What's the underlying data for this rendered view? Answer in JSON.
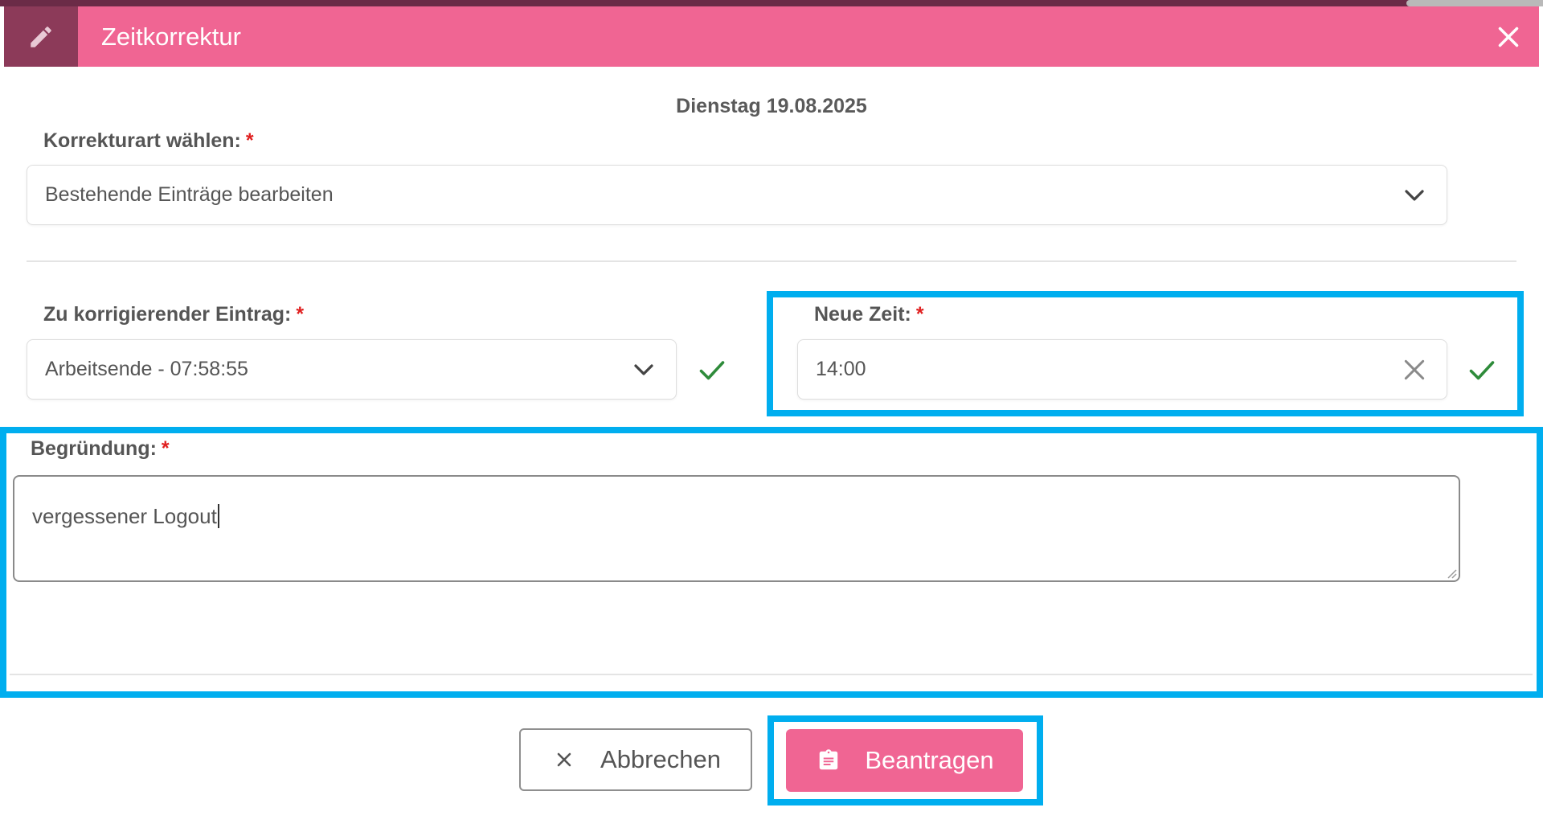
{
  "dialog": {
    "title": "Zeitkorrektur",
    "date": "Dienstag 19.08.2025"
  },
  "correction_type": {
    "label": "Korrekturart wählen:",
    "required_mark": "*",
    "value": "Bestehende Einträge bearbeiten"
  },
  "entry": {
    "label": "Zu korrigierender Eintrag:",
    "required_mark": "*",
    "value": "Arbeitsende - 07:58:55"
  },
  "new_time": {
    "label": "Neue Zeit:",
    "required_mark": "*",
    "value": "14:00"
  },
  "reason": {
    "label": "Begründung:",
    "required_mark": "*",
    "value": "vergessener Logout"
  },
  "buttons": {
    "cancel_label": "Abbrechen",
    "submit_label": "Beantragen"
  },
  "colors": {
    "header": "#f06593",
    "header_icon_bg": "#8c3a59",
    "required": "#e02020",
    "valid_check": "#2e8b3a",
    "highlight": "#00aeef"
  },
  "icons": {
    "header": "pencil-icon",
    "close": "close-icon",
    "dropdown": "chevron-down-icon",
    "valid": "checkmark-icon",
    "clear": "clear-icon",
    "cancel": "x-icon",
    "submit": "clipboard-icon"
  }
}
